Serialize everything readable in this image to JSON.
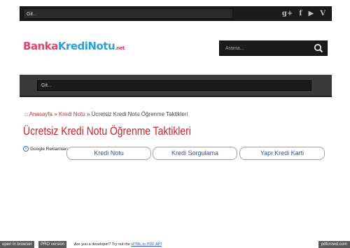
{
  "topbar": {
    "nav_select_value": "Git...",
    "social_icons": [
      "google-plus-icon",
      "facebook-icon",
      "youtube-icon",
      "vimeo-icon"
    ],
    "social_glyphs": [
      "g+",
      "f",
      "▶",
      "V"
    ]
  },
  "header": {
    "logo_part1": "Banka",
    "logo_part2": "KrediNotu",
    "logo_part3": ".net",
    "search_placeholder": "Arama..."
  },
  "nav": {
    "select_value": "Git..."
  },
  "breadcrumb": {
    "home": "Anasayfa",
    "sep": "»",
    "category": "Kredi Notu",
    "current": "Ücretsiz Kredi Notu Öğrenme Taktikleri"
  },
  "article": {
    "title": "Ücretsiz Kredi Notu Öğrenme Taktikleri"
  },
  "ads": {
    "label": "Google Reklamları",
    "buttons": [
      "Kredi Notu",
      "Kredi Sorgulama",
      "Yapı Kredi Karti"
    ]
  },
  "footer": {
    "open_in_browser": "open in browser",
    "pro_version": "PRO version",
    "dev_text": "Are you a developer? Try out the",
    "dev_link": "HTML to PDF API",
    "brand": "pdfcrowd.com"
  },
  "colors": {
    "accent_red": "#c9232b",
    "link_blue": "#2456b8",
    "logo_pink": "#e0436f",
    "logo_blue": "#2aa0d6"
  }
}
